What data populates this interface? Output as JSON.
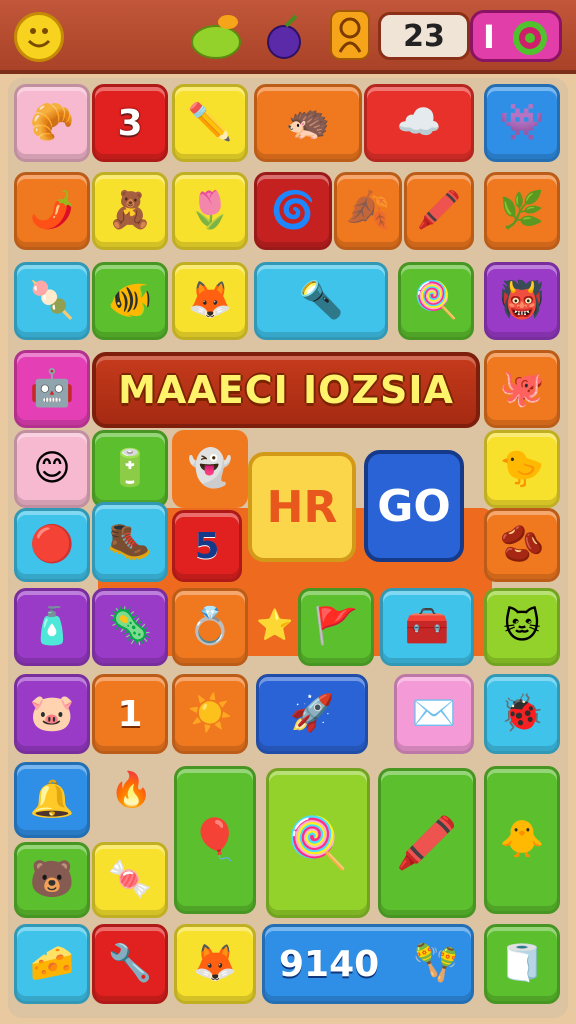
{
  "topbar": {
    "score": "23",
    "pause_label": "I",
    "icons": [
      "smiley-icon",
      "fruit-icon",
      "berry-icon",
      "character-icon",
      "target-icon"
    ]
  },
  "board": {
    "title": "MAAECI IOZSIA",
    "play_label": "HR",
    "go_label": "GO",
    "score_panel": "9140",
    "numbers": {
      "r1": "3",
      "r6": "5",
      "r8": "1"
    }
  },
  "colors": {
    "red": "#e8312a",
    "yellow": "#f7e12d",
    "orange": "#f0781f",
    "green": "#5cbf2e",
    "blue": "#2f8fe6",
    "cyan": "#3fc3ea",
    "purple": "#9a3bc8",
    "pink": "#f6b9cf",
    "magenta": "#e43fb5",
    "dark_red": "#c62121"
  }
}
